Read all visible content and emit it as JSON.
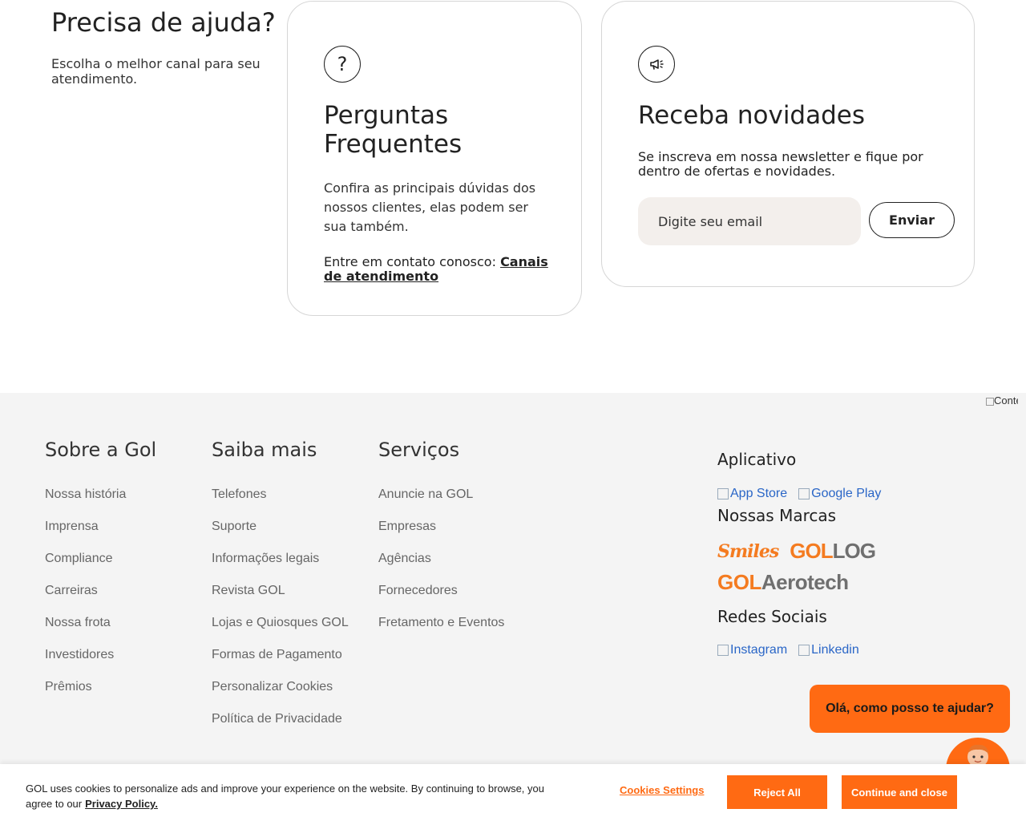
{
  "help": {
    "title": "Precisa de ajuda?",
    "subtitle": "Escolha o melhor canal para seu atendimento."
  },
  "faq_card": {
    "icon": "question-icon",
    "icon_glyph": "?",
    "title": "Perguntas Frequentes",
    "description": "Confira as principais dúvidas dos nossos clientes, elas podem ser sua também.",
    "contact_prefix": "Entre em contato conosco: ",
    "contact_link": "Canais de atendimento"
  },
  "news_card": {
    "icon": "megaphone-icon",
    "title": "Receba novidades",
    "description": "Se inscreva em nossa newsletter e fique por dentro de ofertas e novidades.",
    "email_placeholder": "Digite seu email",
    "send_label": "Enviar"
  },
  "footer": {
    "background": "#f4f4f4",
    "accessibility_alt": "Conteúdo acessível",
    "columns": [
      {
        "title": "Sobre a Gol",
        "items": [
          "Nossa história",
          "Imprensa",
          "Compliance",
          "Carreiras",
          "Nossa frota",
          "Investidores",
          "Prêmios"
        ]
      },
      {
        "title": "Saiba mais",
        "items": [
          "Telefones",
          "Suporte",
          "Informações legais",
          "Revista GOL",
          "Lojas e Quiosques GOL",
          "Formas de Pagamento",
          "Personalizar Cookies",
          "Política de Privacidade"
        ]
      },
      {
        "title": "Serviços",
        "items": [
          "Anuncie na GOL",
          "Empresas",
          "Agências",
          "Fornecedores",
          "Fretamento e Eventos"
        ]
      }
    ],
    "app_title": "Aplicativo",
    "app_store": "App Store",
    "google_play": "Google Play",
    "brands_title": "Nossas Marcas",
    "brand_smiles": "Smiles",
    "brand_gollog_a": "GOL",
    "brand_gollog_b": "LOG",
    "brand_aero_a": "GOL",
    "brand_aero_b": "Aerotech",
    "social_title": "Redes Sociais",
    "instagram": "Instagram",
    "linkedin": "Linkedin"
  },
  "chat": {
    "bubble_text": "Olá, como posso te ajudar?",
    "accent": "#ff6a13"
  },
  "cookie": {
    "text": "GOL uses cookies to personalize ads and improve your experience on the website. By continuing to browse, you agree to our",
    "privacy_link": "Privacy Policy.",
    "settings_label": "Cookies Settings",
    "reject_label": "Reject All",
    "continue_label": "Continue and close",
    "accent": "#ff6a13"
  }
}
